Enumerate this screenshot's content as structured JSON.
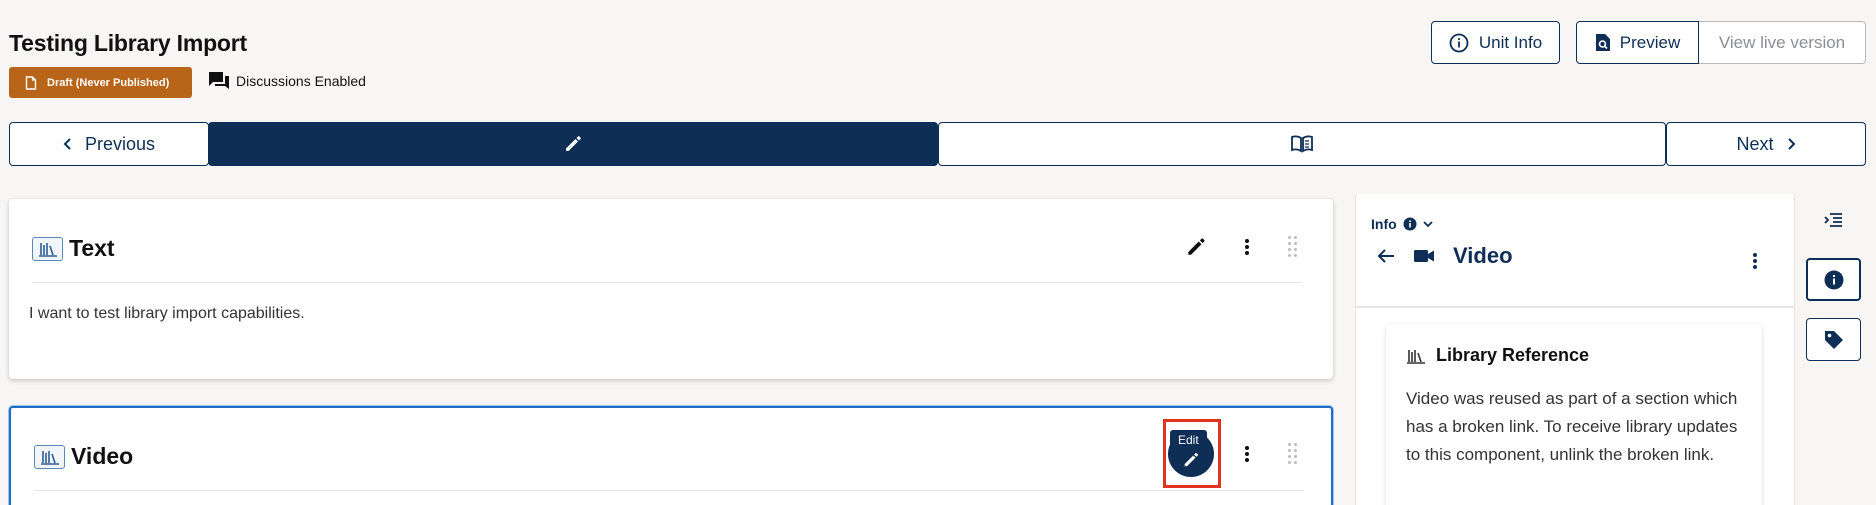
{
  "header": {
    "title": "Testing Library Import",
    "status_badge": "Draft (Never Published)",
    "discussions": "Discussions Enabled",
    "unit_info_label": "Unit Info",
    "preview_label": "Preview",
    "view_live_label": "View live version"
  },
  "nav": {
    "previous_label": "Previous",
    "next_label": "Next"
  },
  "blocks": [
    {
      "title": "Text",
      "body": "I want to test library import capabilities."
    },
    {
      "title": "Video",
      "edit_tooltip": "Edit"
    }
  ],
  "sidebar": {
    "info_label": "Info",
    "title": "Video",
    "library_reference": {
      "title": "Library Reference",
      "text": "Video was reused as part of a section which has a broken link. To receive library updates to this component, unlink the broken link."
    }
  },
  "colors": {
    "brand": "#0e2e55",
    "draft_badge": "#b8651a",
    "highlight": "#e2331e",
    "selected_border": "#1d6ec2"
  },
  "icons": [
    "draft-page-icon",
    "chat-icon",
    "info-icon",
    "preview-search-icon",
    "chevron-left-icon",
    "pencil-icon",
    "book-icon",
    "chevron-right-icon",
    "library-icon",
    "more-vertical-icon",
    "drag-handle-icon",
    "back-arrow-icon",
    "video-camera-icon",
    "collapse-rail-icon",
    "tag-icon"
  ]
}
